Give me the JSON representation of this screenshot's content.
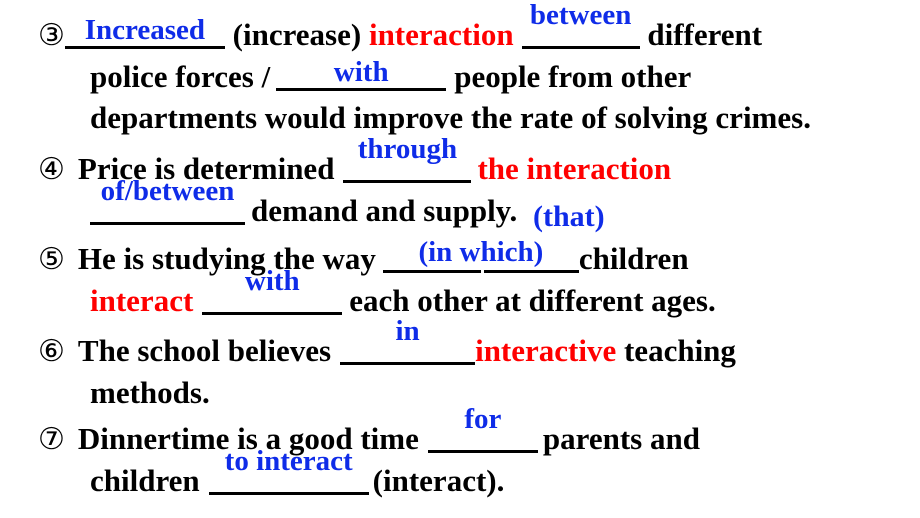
{
  "document": {
    "type": "grammar-worksheet",
    "title": "Fill-in-the-blank grammar exercise (interact / interaction / interactive)",
    "colors": {
      "base_text": "#000000",
      "answer": "#0f2ce8",
      "keyword": "#ff0000",
      "background": "#ffffff",
      "blank_rule": "#000000"
    }
  },
  "items": [
    {
      "marker": "③",
      "lines": [
        {
          "segments": [
            {
              "kind": "blank",
              "answer": "Increased",
              "color": "answer"
            },
            {
              "kind": "text",
              "text": " (increase) ",
              "color": "base"
            },
            {
              "kind": "text",
              "text": "interaction",
              "color": "keyword"
            },
            {
              "kind": "blank",
              "answer": "between",
              "color": "answer"
            },
            {
              "kind": "text",
              "text": " different",
              "color": "base"
            }
          ]
        },
        {
          "segments": [
            {
              "kind": "text",
              "text": "police forces  / ",
              "color": "base"
            },
            {
              "kind": "blank",
              "answer": "with",
              "color": "answer"
            },
            {
              "kind": "text",
              "text": " people from other",
              "color": "base"
            }
          ]
        },
        {
          "segments": [
            {
              "kind": "text",
              "text": "departments would improve the rate of solving crimes.",
              "color": "base"
            }
          ]
        }
      ]
    },
    {
      "marker": "④",
      "lines": [
        {
          "segments": [
            {
              "kind": "text",
              "text": "Price is determined ",
              "color": "base"
            },
            {
              "kind": "blank",
              "answer": "through",
              "color": "answer"
            },
            {
              "kind": "text",
              "text": " the interaction",
              "color": "keyword"
            }
          ]
        },
        {
          "segments": [
            {
              "kind": "blank",
              "answer": "of/between",
              "color": "answer"
            },
            {
              "kind": "text",
              "text": " demand and supply.",
              "color": "base"
            },
            {
              "kind": "text",
              "text": "(that)",
              "color": "answer"
            }
          ]
        }
      ]
    },
    {
      "marker": "⑤",
      "lines": [
        {
          "segments": [
            {
              "kind": "text",
              "text": "He is studying the way ",
              "color": "base"
            },
            {
              "kind": "blank",
              "answer": "(in which)",
              "color": "answer"
            },
            {
              "kind": "text",
              "text": "children",
              "color": "base"
            }
          ]
        },
        {
          "segments": [
            {
              "kind": "text",
              "text": "interact",
              "color": "keyword"
            },
            {
              "kind": "blank",
              "answer": "with",
              "color": "answer"
            },
            {
              "kind": "text",
              "text": " each other at different ages.",
              "color": "base"
            }
          ]
        }
      ]
    },
    {
      "marker": "⑥",
      "lines": [
        {
          "segments": [
            {
              "kind": "text",
              "text": "The school believes ",
              "color": "base"
            },
            {
              "kind": "blank",
              "answer": "in",
              "color": "answer"
            },
            {
              "kind": "text",
              "text": "interactive",
              "color": "keyword"
            },
            {
              "kind": "text",
              "text": " teaching",
              "color": "base"
            }
          ]
        },
        {
          "segments": [
            {
              "kind": "text",
              "text": "methods.",
              "color": "base"
            }
          ]
        }
      ]
    },
    {
      "marker": "⑦",
      "lines": [
        {
          "segments": [
            {
              "kind": "text",
              "text": "Dinnertime is a good time ",
              "color": "base"
            },
            {
              "kind": "blank",
              "answer": "for",
              "color": "answer"
            },
            {
              "kind": "text",
              "text": " parents and",
              "color": "base"
            }
          ]
        },
        {
          "segments": [
            {
              "kind": "text",
              "text": "children ",
              "color": "base"
            },
            {
              "kind": "blank",
              "answer": "to interact",
              "color": "answer"
            },
            {
              "kind": "text",
              "text": " (interact).",
              "color": "base"
            }
          ]
        }
      ]
    }
  ],
  "text": {
    "i3_l1_increase_cue": " (increase) ",
    "i3_l1_interaction": "interaction",
    "i3_l1_tail": " different",
    "i3_ans_increased": "Increased",
    "i3_ans_between": "between",
    "i3_l2_head": "police forces  /",
    "i3_l2_tail": "people from other",
    "i3_ans_with": "with",
    "i3_l3": "departments would improve the rate of solving crimes.",
    "i4_l1_head": "Price is determined",
    "i4_l1_red": "the interaction",
    "i4_ans_through": "through",
    "i4_ans_ofbetween": "of/between",
    "i4_l2_tail": "demand and supply.",
    "i4_ans_that": "(that)",
    "i5_l1_head": "He is studying the way",
    "i5_l1_tail": "children",
    "i5_ans_inwhich": "(in which)",
    "i5_l2_red": "interact",
    "i5_ans_with": "with",
    "i5_l2_tail": "each other at different ages.",
    "i6_l1_head": "The school believes",
    "i6_ans_in": "in",
    "i6_l1_red": "interactive",
    "i6_l1_tail": " teaching",
    "i6_l2": "methods.",
    "i7_l1_head": "Dinnertime is a good time",
    "i7_ans_for": "for",
    "i7_l1_tail": "parents and",
    "i7_l2_head": "children",
    "i7_ans_tointeract": "to interact",
    "i7_l2_tail": "(interact)."
  },
  "markers": {
    "m3": "③",
    "m4": "④",
    "m5": "⑤",
    "m6": "⑥",
    "m7": "⑦"
  }
}
